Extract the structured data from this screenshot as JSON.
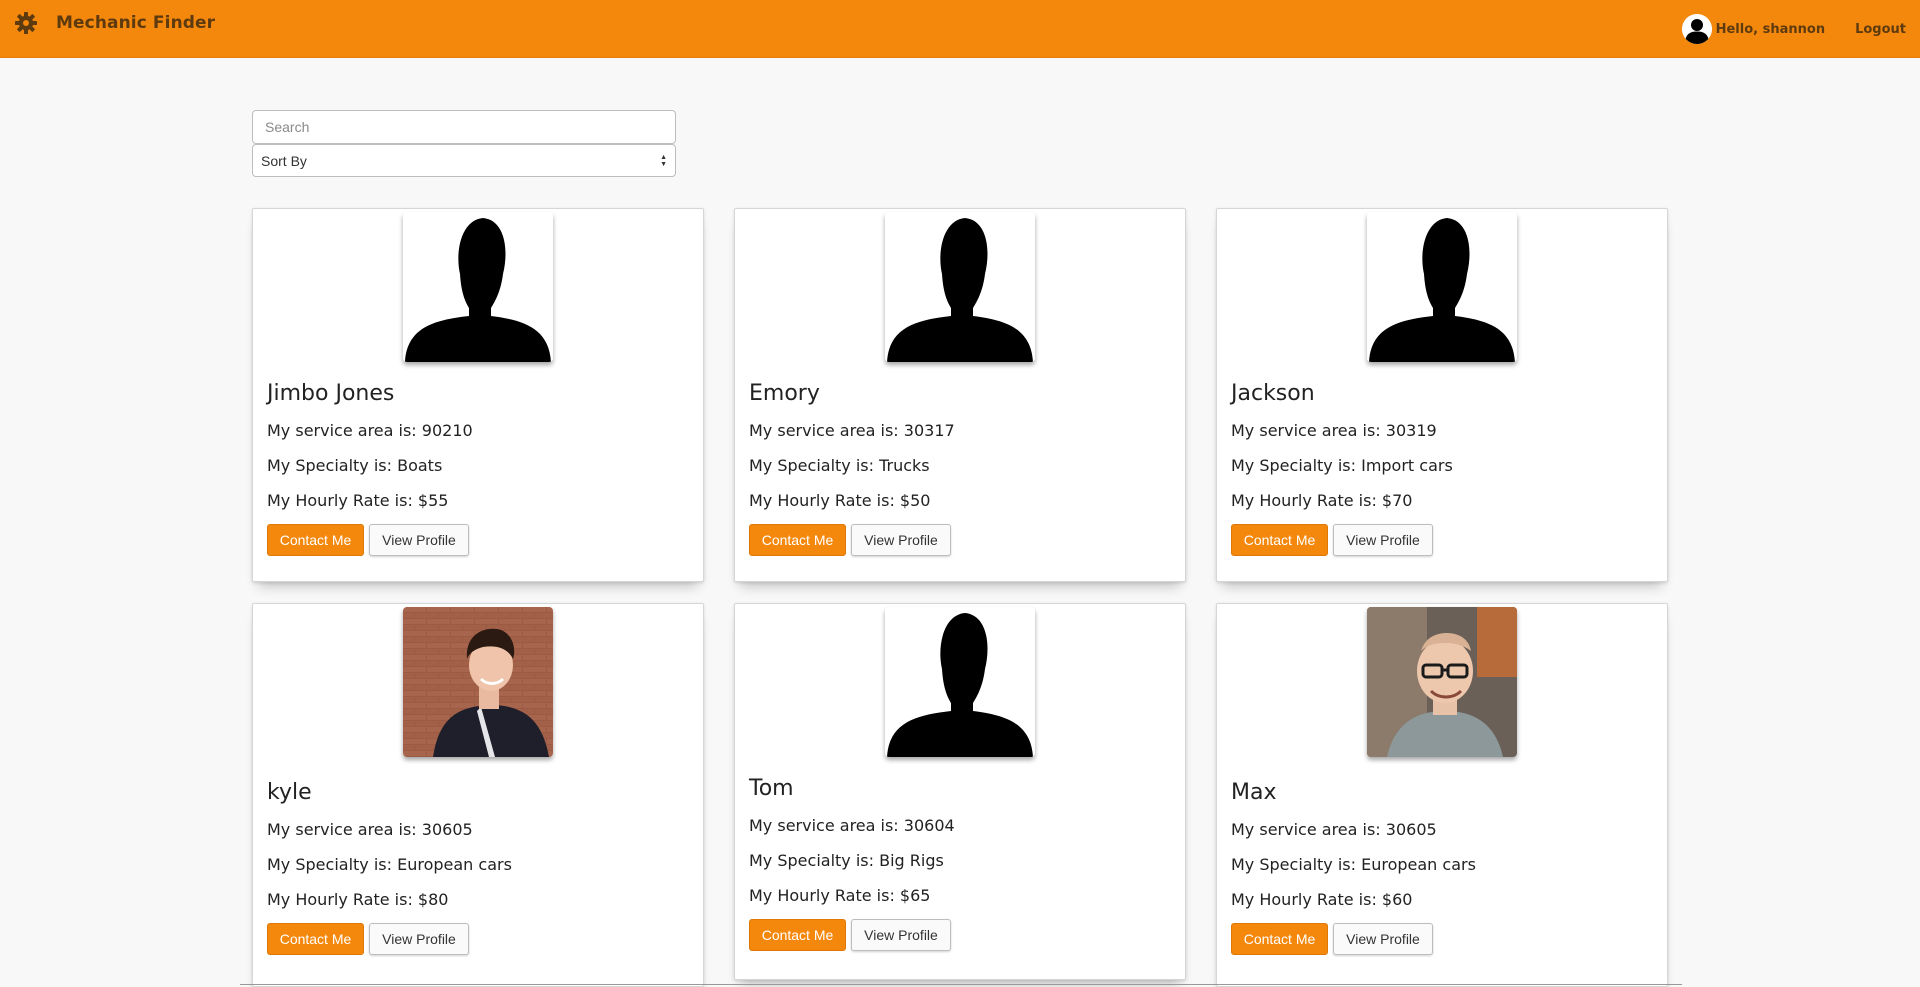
{
  "app": {
    "brand_label": "Mechanic Finder",
    "greeting": "Hello, shannon",
    "logout_label": "Logout",
    "accent_color": "#f4880d"
  },
  "filters": {
    "search_placeholder": "Search",
    "sort_label": "Sort By"
  },
  "mechanics": [
    {
      "name": "Jimbo Jones",
      "area": "My service area is: 90210",
      "specialty": "My Specialty is: Boats",
      "rate": "My Hourly Rate is: $55",
      "photo": "silhouette-icon",
      "contact_label": "Contact Me",
      "profile_label": "View Profile"
    },
    {
      "name": "Emory",
      "area": "My service area is: 30317",
      "specialty": "My Specialty is: Trucks",
      "rate": "My Hourly Rate is: $50",
      "photo": "silhouette-icon",
      "contact_label": "Contact Me",
      "profile_label": "View Profile"
    },
    {
      "name": "Jackson",
      "area": "My service area is: 30319",
      "specialty": "My Specialty is: Import cars",
      "rate": "My Hourly Rate is: $70",
      "photo": "silhouette-icon",
      "contact_label": "Contact Me",
      "profile_label": "View Profile"
    },
    {
      "name": "kyle",
      "area": "My service area is: 30605",
      "specialty": "My Specialty is: European cars",
      "rate": "My Hourly Rate is: $80",
      "photo": "portrait-photo",
      "contact_label": "Contact Me",
      "profile_label": "View Profile"
    },
    {
      "name": "Tom",
      "area": "My service area is: 30604",
      "specialty": "My Specialty is: Big Rigs",
      "rate": "My Hourly Rate is: $65",
      "photo": "silhouette-icon",
      "contact_label": "Contact Me",
      "profile_label": "View Profile"
    },
    {
      "name": "Max",
      "area": "My service area is: 30605",
      "specialty": "My Specialty is: European cars",
      "rate": "My Hourly Rate is: $60",
      "photo": "portrait-photo",
      "contact_label": "Contact Me",
      "profile_label": "View Profile"
    }
  ]
}
